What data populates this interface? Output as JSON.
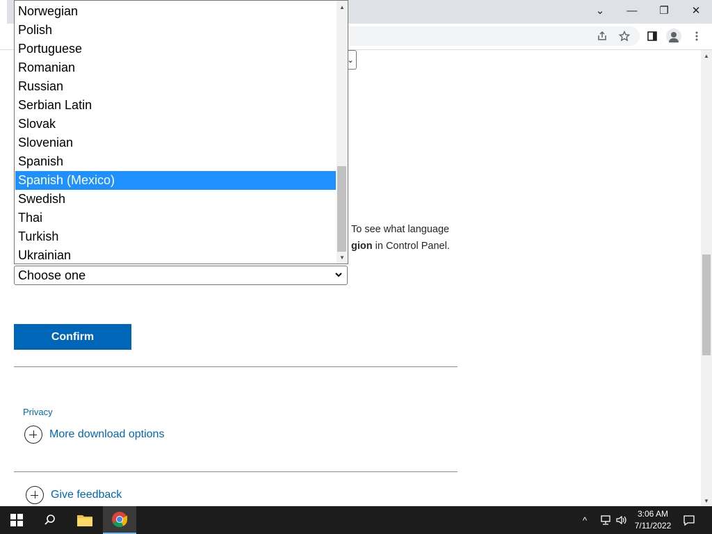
{
  "browser": {
    "window_controls": {
      "minimize": "—",
      "restore": "❐",
      "close": "✕",
      "tab_search": "⌄"
    }
  },
  "page": {
    "top_select_chevron": "⌄",
    "description_line1": "To see what language",
    "description_bold": "gion",
    "description_line2_rest": " in Control Panel.",
    "language_select_value": "Choose one",
    "confirm_label": "Confirm",
    "privacy_link": "Privacy",
    "more_download_options": "More download options",
    "give_feedback": "Give feedback"
  },
  "dropdown": {
    "options": [
      "Norwegian",
      "Polish",
      "Portuguese",
      "Romanian",
      "Russian",
      "Serbian Latin",
      "Slovak",
      "Slovenian",
      "Spanish",
      "Spanish (Mexico)",
      "Swedish",
      "Thai",
      "Turkish",
      "Ukrainian"
    ],
    "selected": "Spanish (Mexico)"
  },
  "taskbar": {
    "time": "3:06 AM",
    "date": "7/11/2022",
    "accent_color": "#76b9ed"
  },
  "colors": {
    "link_blue": "#0067b8",
    "selected_option_bg": "#1e90ff",
    "confirm_bg": "#0067b8"
  }
}
